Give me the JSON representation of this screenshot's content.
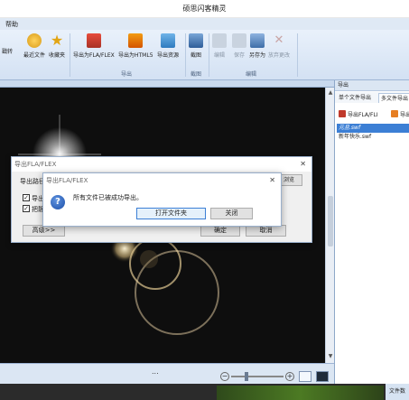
{
  "window": {
    "title": "硕思闪客精灵"
  },
  "menu": {
    "help": "帮助"
  },
  "ribbon": {
    "buttons": [
      {
        "label": "戳转",
        "icon": "jump-icon"
      },
      {
        "label": "最近文件",
        "icon": "recent-files-icon"
      },
      {
        "label": "收藏夹",
        "icon": "favorites-icon"
      },
      {
        "label": "导出为FLA/FLEX",
        "icon": "export-fla-icon"
      },
      {
        "label": "导出为HTML5",
        "icon": "export-html5-icon"
      },
      {
        "label": "导出资源",
        "icon": "export-resources-icon"
      },
      {
        "label": "截图",
        "icon": "screenshot-icon"
      },
      {
        "label": "编辑",
        "icon": "edit-icon"
      },
      {
        "label": "保存",
        "icon": "save-icon"
      },
      {
        "label": "另存为",
        "icon": "save-as-icon"
      },
      {
        "label": "放弃更改",
        "icon": "discard-icon"
      }
    ],
    "groups": {
      "export": "导出",
      "screenshot": "截图",
      "edit": "编辑"
    }
  },
  "right_panel": {
    "title": "导出",
    "tabs": [
      "单个文件导出",
      "多文件导出"
    ],
    "buttons": [
      "导出FLA/FLI",
      "导出"
    ],
    "files": [
      "元旦.swf",
      "新年快乐.swf"
    ]
  },
  "dialog_export": {
    "title": "导出FLA/FLEX",
    "path_label": "导出路径",
    "browse": "浏览",
    "checkbox1_label": "导出",
    "checkbox2_label": "把静",
    "advanced": "高级>>",
    "ok": "确定",
    "cancel": "取消"
  },
  "dialog_message": {
    "title": "导出FLA/FLEX",
    "message": "所有文件已被成功导出。",
    "open_folder": "打开文件夹",
    "close": "关闭"
  },
  "stage_bar": {
    "dots": "..."
  },
  "status": {
    "label": "文件数"
  },
  "colors": {
    "accent": "#3c7fd5",
    "ribbon": "#d3e1f3",
    "stage": "#0e0e0e"
  }
}
